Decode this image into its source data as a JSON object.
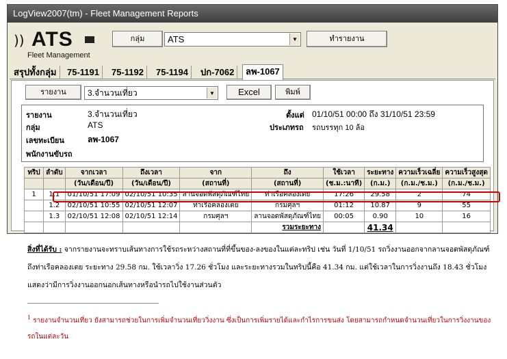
{
  "window": {
    "title": "LogView2007(tm) - Fleet Management Reports"
  },
  "logo": {
    "brand": "ATS",
    "tagline": "Fleet Management"
  },
  "header": {
    "group_button": "กลุ่ม",
    "group_value": "ATS",
    "run_button": "ทำรายงาน"
  },
  "tabs": [
    "สรุปทั้งกลุ่ม",
    "75-1191",
    "75-1192",
    "75-1194",
    "ปก-7062",
    "ลพ-1067"
  ],
  "toolbar": {
    "report_button": "รายงาน",
    "report_value": "3.จำนวนเที่ยว",
    "excel_button": "Excel",
    "print_button": "พิมพ์"
  },
  "info": {
    "report_label": "รายงาน",
    "report_value": "3.จำนวนเที่ยว",
    "group_label": "กลุ่ม",
    "group_value": "ATS",
    "plate_label": "เลขทะเบียน",
    "plate_value": "ลพ-1067",
    "driver_label": "พนักงานขับรถ",
    "since_label": "ตั้งแต่",
    "since_value": "01/10/51  00:00 ถึง 31/10/51  23:59",
    "type_label": "ประเภทรถ",
    "type_value": "รถบรรทุก 10 ล้อ"
  },
  "table": {
    "headers1": [
      "ทริป",
      "ลำดับ",
      "จากเวลา",
      "ถึงเวลา",
      "จาก",
      "ถึง",
      "ใช้เวลา",
      "ระยะทาง",
      "ความเร็วเฉลี่ย",
      "ความเร็วสูงสุด"
    ],
    "headers2": [
      "",
      "",
      "(วัน/เดือน/ปี)",
      "(วัน/เดือน/ปี)",
      "(สถานที่)",
      "(สถานที่)",
      "(ช.ม.:นาที)",
      "(ก.ม.)",
      "(ก.ม./ช.ม.)",
      "(ก.ม./ช.ม.)"
    ],
    "rows": [
      [
        "1",
        "1.1",
        "01/10/51  17:09",
        "02/10/51  10:35",
        "ลานจอดพัสดุภัณฑ์ไทย",
        "ท่าเรือคลองเตย",
        "17:26",
        "29.58",
        "2",
        "74"
      ],
      [
        "",
        "1.2",
        "02/10/51  10:55",
        "02/10/51  12:07",
        "ท่าเรือคลองเตย",
        "กรมศุลฯ",
        "01:12",
        "10.87",
        "9",
        "55"
      ],
      [
        "",
        "1.3",
        "02/10/51  12:08",
        "02/10/51  12:14",
        "กรมศุลฯ",
        "ลานจอดพัสดุภัณฑ์ไทย",
        "00:05",
        "0.90",
        "10",
        "16"
      ]
    ],
    "total_label": "รวมระยะทาง",
    "total_value": "41.34"
  },
  "description": {
    "heading": "สิ่งที่ได้รับ :",
    "body": " จากรายงานจะทราบเส้นทางการใช้รถระหว่างสถานที่ที่ขึ้นของ-ลงของในแต่ละทริป  เช่น  วันที่  1/10/51  รถวิ่งงานออกจากลานจอดพัสดุภัณฑ์ถึงท่าเรือคลองเตย ระยะทาง 29.58 กม. ใช้เวลาวิ่ง 17.26 ชั่วโมง และระยะทางรวมในทริปนี้คือ 41.34 กม. แต่ใช้เวลาในการวิ่งงานถึง 18.43 ชั่วโมงแสดงว่ามีการวิ่งงานออกนอกเส้นทางหรือนำรถไปใช้งานส่วนตัว"
  },
  "footnote": {
    "marker": "1",
    "text": " รายงานจำนวนเที่ยว ยังสามารถช่วยในการเพิ่มจำนวนเที่ยววิ่งงาน ซึ่งเป็นการเพิ่มรายได้และกำไรการขนส่ง โดยสามารถกำหนดจำนวนเที่ยวในการวิ่งงานของรถในแต่ละวัน"
  }
}
